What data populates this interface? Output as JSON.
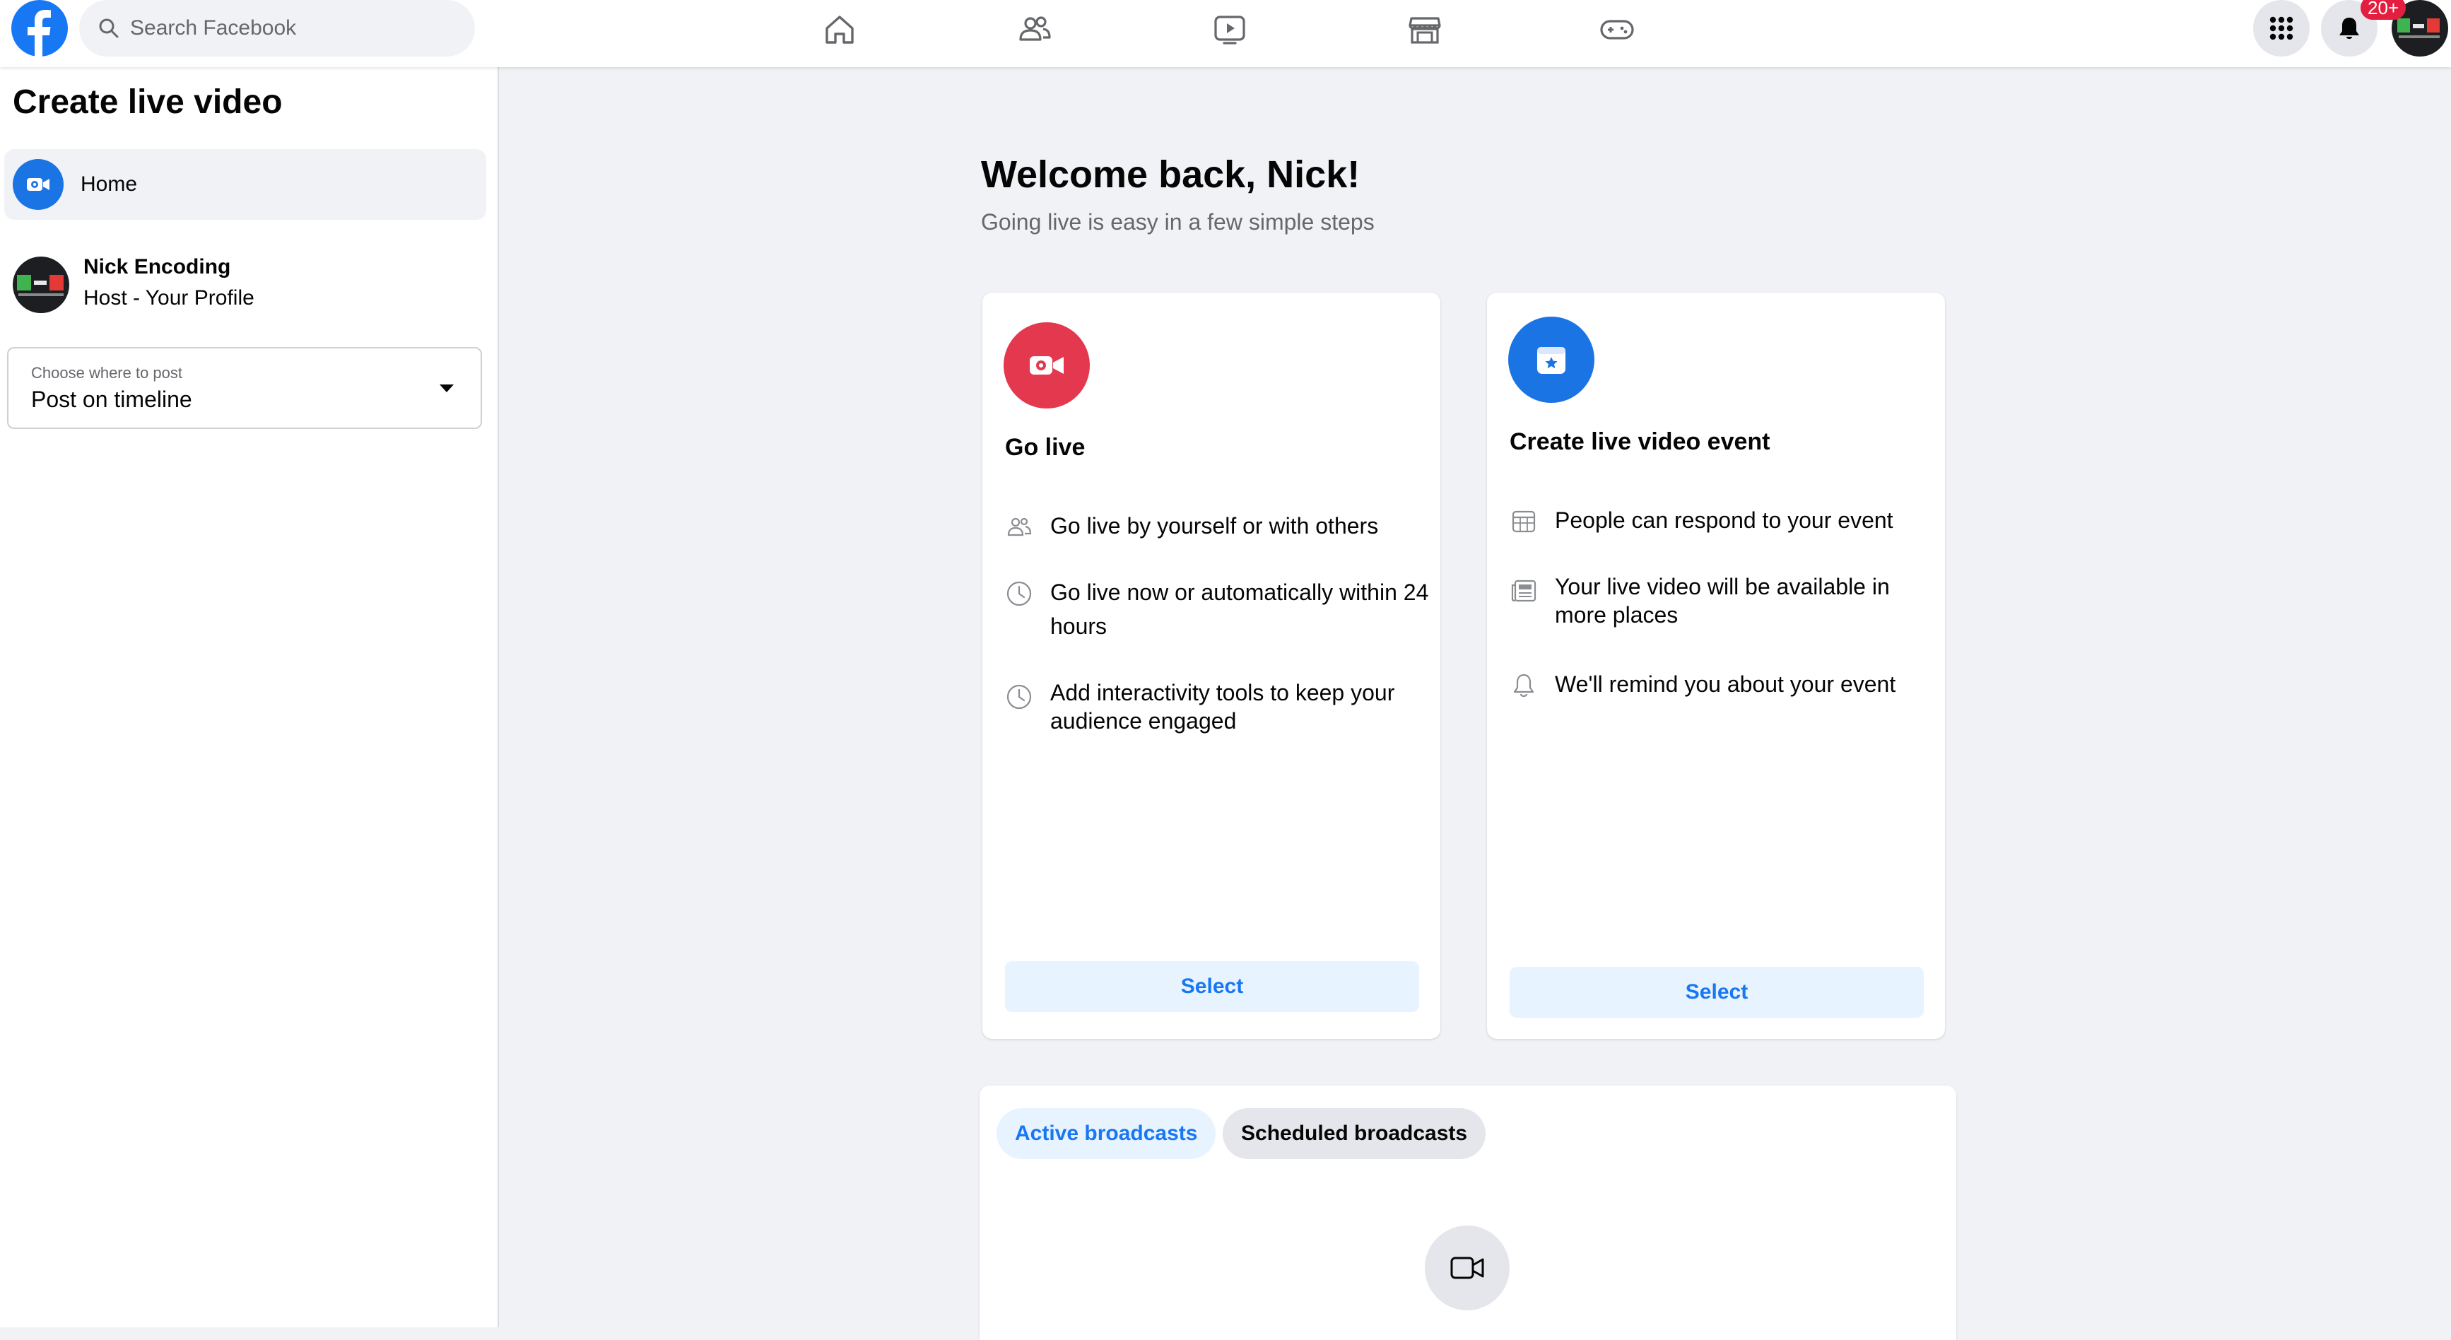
{
  "colors": {
    "brand_blue": "#1877f2",
    "go_live_red": "#e4384f",
    "badge_red": "#e41e3f",
    "select_bg": "#e7f3ff",
    "page_bg": "#f0f2f5"
  },
  "header": {
    "logo_icon": "facebook-logo-icon",
    "search": {
      "placeholder": "Search Facebook",
      "icon": "search-icon"
    },
    "nav": [
      "home-icon",
      "friends-icon",
      "watch-icon",
      "marketplace-icon",
      "gaming-icon"
    ],
    "menu_icon": "grid-menu-icon",
    "notifications_icon": "bell-icon",
    "notification_badge": "20+"
  },
  "sidebar": {
    "title": "Create live video",
    "home_label": "Home",
    "host": {
      "name": "Nick Encoding",
      "subtitle": "Host - Your Profile"
    },
    "post_select": {
      "label": "Choose where to post",
      "value": "Post on timeline"
    }
  },
  "main": {
    "welcome_title": "Welcome back, Nick!",
    "welcome_subtitle": "Going live is easy in a few simple steps",
    "cards": [
      {
        "title": "Go live",
        "icon": "live-camera-icon",
        "features": [
          {
            "icon": "people-icon",
            "text": "Go live by yourself or with others"
          },
          {
            "icon": "clock-icon",
            "text": "Go live now or automatically within 24 hours"
          },
          {
            "icon": "clock-icon",
            "text": "Add interactivity tools to keep your audience engaged"
          }
        ],
        "button": "Select"
      },
      {
        "title": "Create live video event",
        "icon": "calendar-star-icon",
        "features": [
          {
            "icon": "calendar-grid-icon",
            "text": "People can respond to your event"
          },
          {
            "icon": "newsfeed-icon",
            "text": "Your live video will be available in more places"
          },
          {
            "icon": "bell-icon",
            "text": "We'll remind you about your event"
          }
        ],
        "button": "Select"
      }
    ],
    "tabs": [
      "Active broadcasts",
      "Scheduled broadcasts"
    ],
    "empty_state_icon": "video-camera-icon"
  }
}
